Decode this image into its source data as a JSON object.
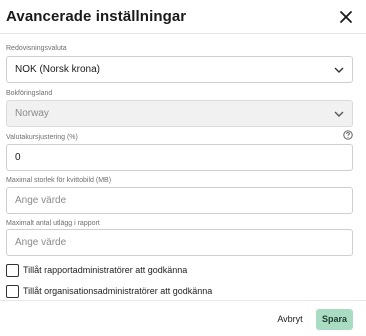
{
  "dialog": {
    "title": "Avancerade inställningar",
    "close_icon": "close-icon"
  },
  "fields": {
    "currency": {
      "label": "Redovisningsvaluta",
      "value": "NOK (Norsk krona)",
      "icon": "chevron-down-icon"
    },
    "country": {
      "label": "Bokföringsland",
      "value": "Norway",
      "icon": "chevron-down-icon",
      "disabled": true
    },
    "exchange_adjustment": {
      "label": "Valutakursjustering (%)",
      "value": "0",
      "help_icon": "help-circle-icon"
    },
    "max_receipt_size": {
      "label": "Maximal storlek för kvittobild (MB)",
      "placeholder": "Ange värde"
    },
    "max_expenses": {
      "label": "Maximalt antal utlägg i rapport",
      "placeholder": "Ange värde"
    }
  },
  "checkboxes": [
    {
      "label": "Tillåt rapportadministratörer att godkänna",
      "checked": false
    },
    {
      "label": "Tillåt organisationsadministratörer att godkänna",
      "checked": false
    }
  ],
  "footer": {
    "cancel_label": "Avbryt",
    "save_label": "Spara"
  },
  "colors": {
    "save_button_bg": "#a9dcc3",
    "disabled_field_bg": "#f1f1f1"
  }
}
